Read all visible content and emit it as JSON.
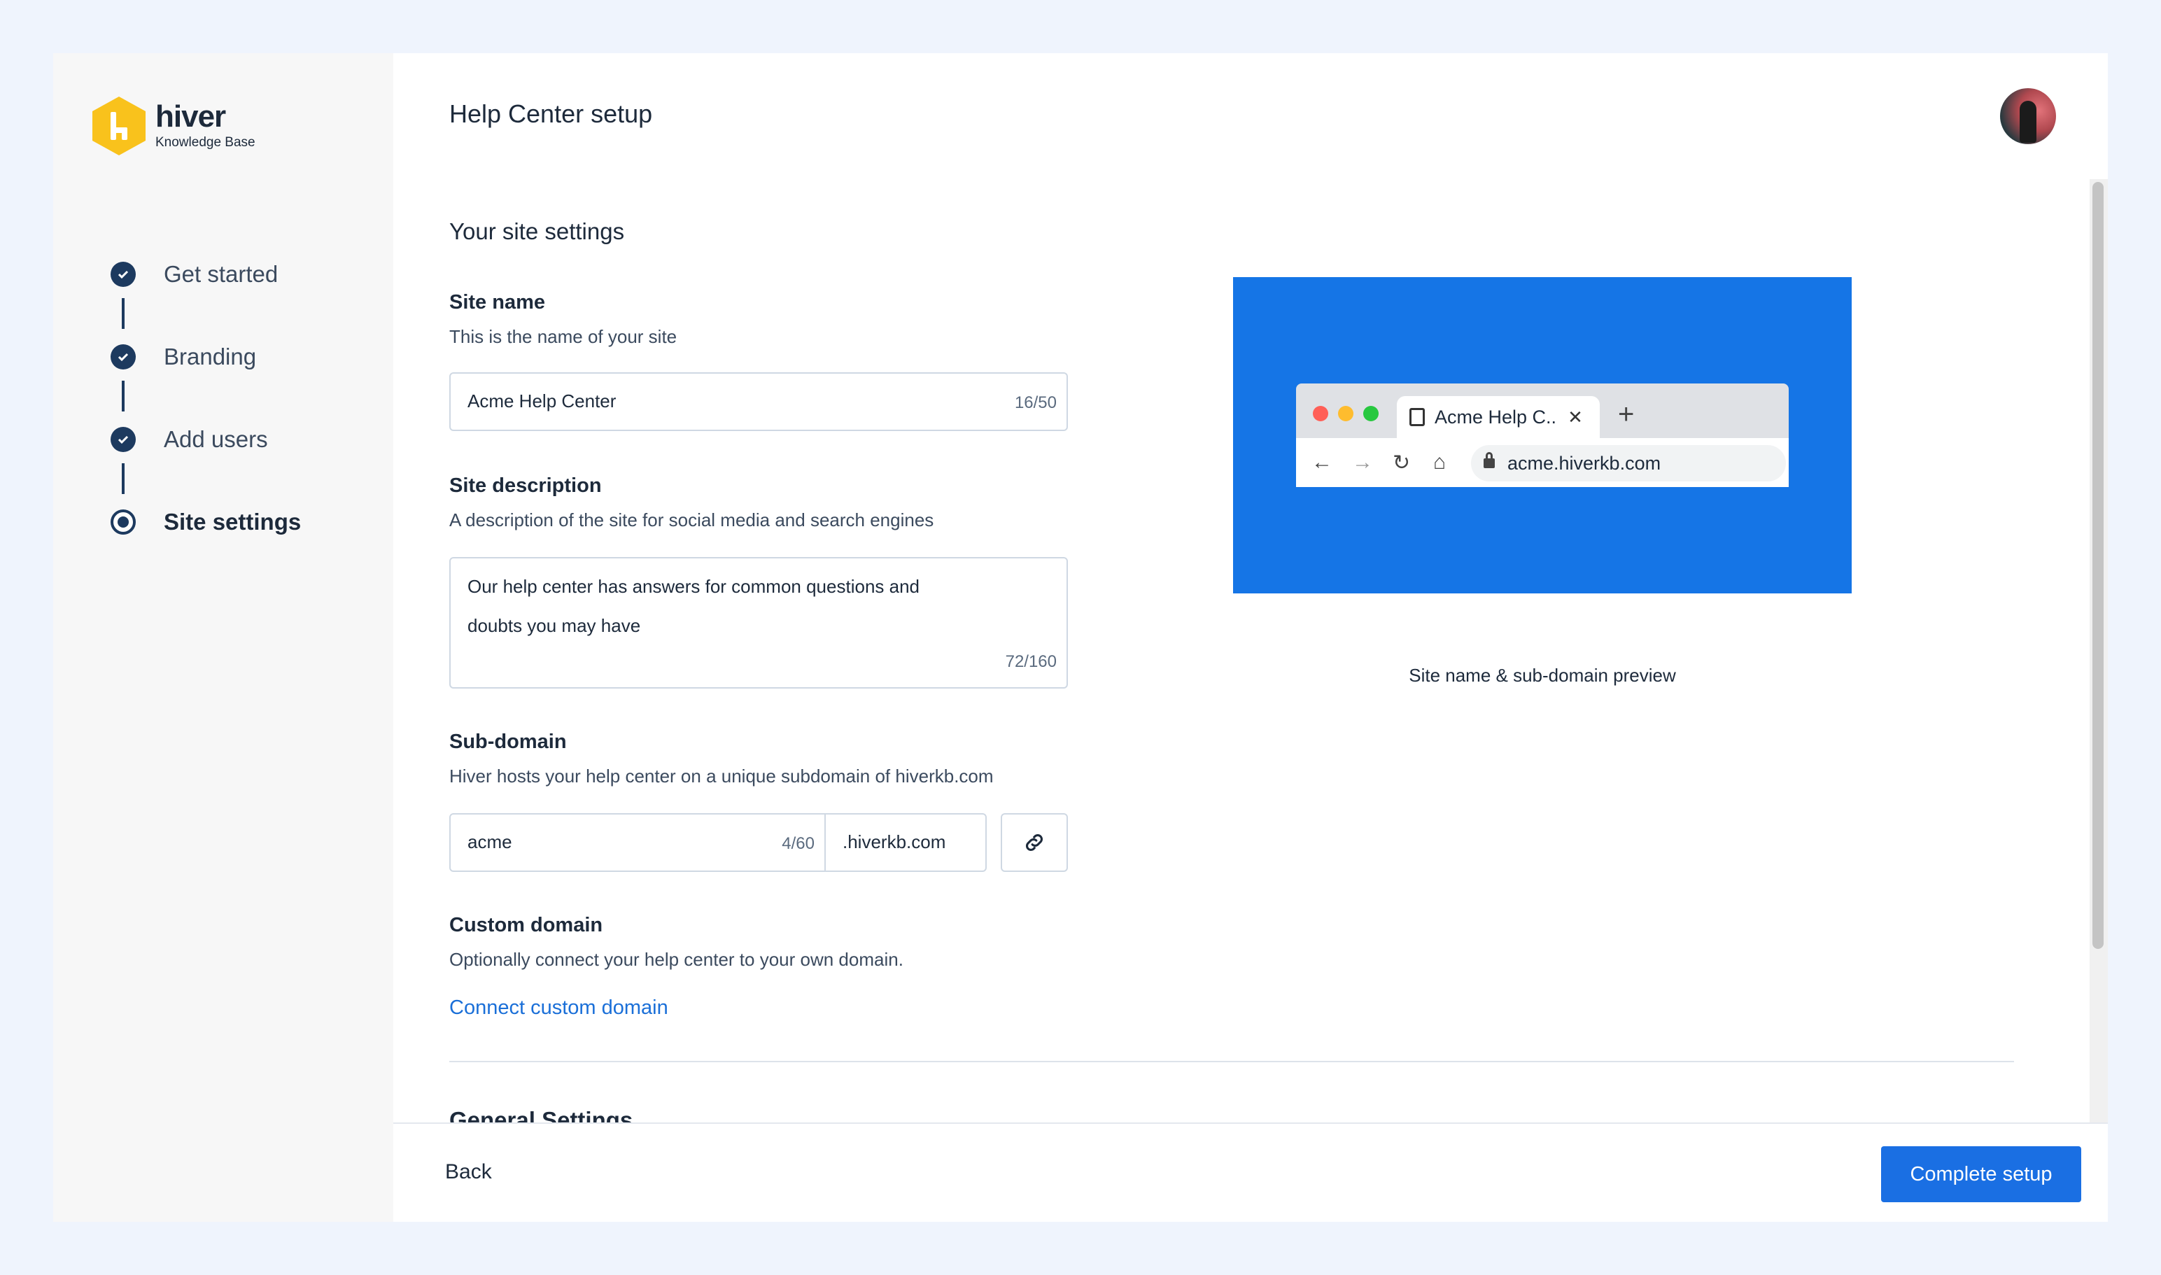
{
  "brand": {
    "name": "hiver",
    "subtitle": "Knowledge Base",
    "color": "#f9c21c"
  },
  "steps": [
    {
      "label": "Get started",
      "state": "done"
    },
    {
      "label": "Branding",
      "state": "done"
    },
    {
      "label": "Add users",
      "state": "done"
    },
    {
      "label": "Site settings",
      "state": "current"
    }
  ],
  "header": {
    "title": "Help Center setup"
  },
  "form": {
    "section_title": "Your site settings",
    "site_name": {
      "label": "Site name",
      "help": "This is the name of your site",
      "value": "Acme Help Center",
      "count": "16/50"
    },
    "site_description": {
      "label": "Site description",
      "help": "A description of the site for social media and search engines",
      "value": "Our help center has answers for common questions and doubts you may have",
      "count": "72/160"
    },
    "subdomain": {
      "label": "Sub-domain",
      "help": "Hiver hosts your help center on a unique subdomain of hiverkb.com",
      "value": "acme",
      "count": "4/60",
      "suffix": ".hiverkb.com"
    },
    "custom_domain": {
      "label": "Custom domain",
      "help": "Optionally connect your help center to your own domain.",
      "link": "Connect custom domain"
    },
    "general_title": "General Settings"
  },
  "preview": {
    "tab_title": "Acme Help C..",
    "url": "acme.hiverkb.com",
    "caption": "Site name & sub-domain preview",
    "background": "#1575e6"
  },
  "footer": {
    "back_label": "Back",
    "complete_label": "Complete setup",
    "accent": "#1a6fe3"
  }
}
